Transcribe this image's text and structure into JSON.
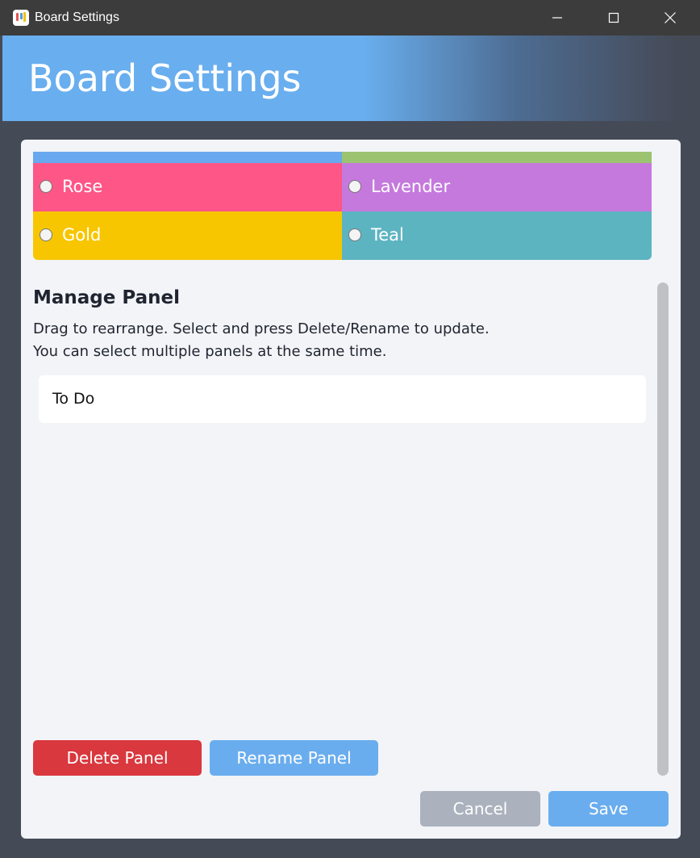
{
  "window": {
    "title": "Board Settings",
    "controls": [
      "minimize-icon",
      "maximize-icon",
      "close-icon"
    ]
  },
  "header": {
    "title": "Board Settings"
  },
  "colors": {
    "accent": "#69aeee",
    "rose": "#fd5687",
    "lavender": "#c579dd",
    "gold": "#f7c600",
    "teal": "#5db4c1",
    "delete": "#d9383e",
    "cancel": "#abb1bd"
  },
  "color_options": [
    {
      "label": "Rose",
      "selected": false
    },
    {
      "label": "Lavender",
      "selected": false
    },
    {
      "label": "Gold",
      "selected": false
    },
    {
      "label": "Teal",
      "selected": false
    }
  ],
  "manage": {
    "title": "Manage Panel",
    "description_line1": "Drag to rearrange. Select and press Delete/Rename to update.",
    "description_line2": "You can select multiple panels at the same time.",
    "panels": [
      "To Do"
    ]
  },
  "buttons": {
    "delete": "Delete Panel",
    "rename": "Rename Panel",
    "cancel": "Cancel",
    "save": "Save"
  }
}
